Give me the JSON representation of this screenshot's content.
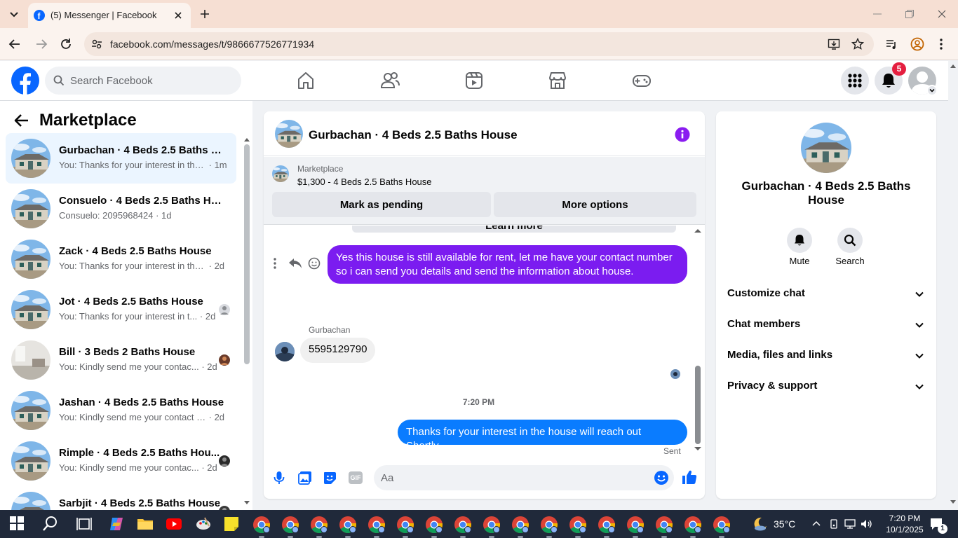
{
  "browser": {
    "tab_title": "(5) Messenger | Facebook",
    "url": "facebook.com/messages/t/9866677526771934"
  },
  "header": {
    "search_placeholder": "Search Facebook",
    "notification_count": "5"
  },
  "sidebar": {
    "title": "Marketplace",
    "conversations": [
      {
        "name": "Gurbachan · 4 Beds 2.5 Baths H...",
        "preview": "You: Thanks for your interest in the...",
        "time": "1m"
      },
      {
        "name": "Consuelo · 4 Beds 2.5 Baths Hou...",
        "preview": "Consuelo: 2095968424",
        "time": "1d"
      },
      {
        "name": "Zack · 4 Beds 2.5 Baths House",
        "preview": "You: Thanks for your interest in the ...",
        "time": "2d"
      },
      {
        "name": "Jot · 4 Beds 2.5 Baths House",
        "preview": "You: Thanks for your interest in t...",
        "time": "2d"
      },
      {
        "name": "Bill · 3 Beds 2 Baths House",
        "preview": "You: Kindly send me your contac...",
        "time": "2d"
      },
      {
        "name": "Jashan · 4 Beds 2.5 Baths House",
        "preview": "You: Kindly send me your contact n...",
        "time": "2d"
      },
      {
        "name": "Rimple · 4 Beds 2.5 Baths Hou...",
        "preview": "You: Kindly send me your contac...",
        "time": "2d"
      },
      {
        "name": "Sarbjit · 4 Beds 2.5 Baths House",
        "preview": "",
        "time": ""
      }
    ]
  },
  "chat": {
    "title": "Gurbachan · 4 Beds 2.5 Baths House",
    "banner_label": "Marketplace",
    "banner_listing": "$1,300 - 4 Beds 2.5 Baths House",
    "mark_pending_label": "Mark as pending",
    "more_options_label": "More options",
    "partial_button_label": "Learn more",
    "message_out_1": "Yes this house is still available for rent, let me have your contact number so i can send you details and send the information about house.",
    "sender_name": "Gurbachan",
    "message_in_1": "5595129790",
    "timestamp": "7:20 PM",
    "message_out_2": "Thanks for your interest in the house will reach out Shortly.",
    "status": "Sent",
    "composer_placeholder": "Aa",
    "gif_label": "GIF"
  },
  "details": {
    "name": "Gurbachan · 4 Beds 2.5 Baths House",
    "mute_label": "Mute",
    "search_label": "Search",
    "sections": [
      "Customize chat",
      "Chat members",
      "Media, files and links",
      "Privacy & support"
    ]
  },
  "taskbar": {
    "weather": "35°C",
    "time": "7:20 PM",
    "date": "10/1/2025",
    "notification_count": "1"
  },
  "colors": {
    "fb_blue": "#0866ff",
    "message_blue": "#0a7cff",
    "message_purple": "#7b1cf0",
    "badge_red": "#e41e3f"
  }
}
